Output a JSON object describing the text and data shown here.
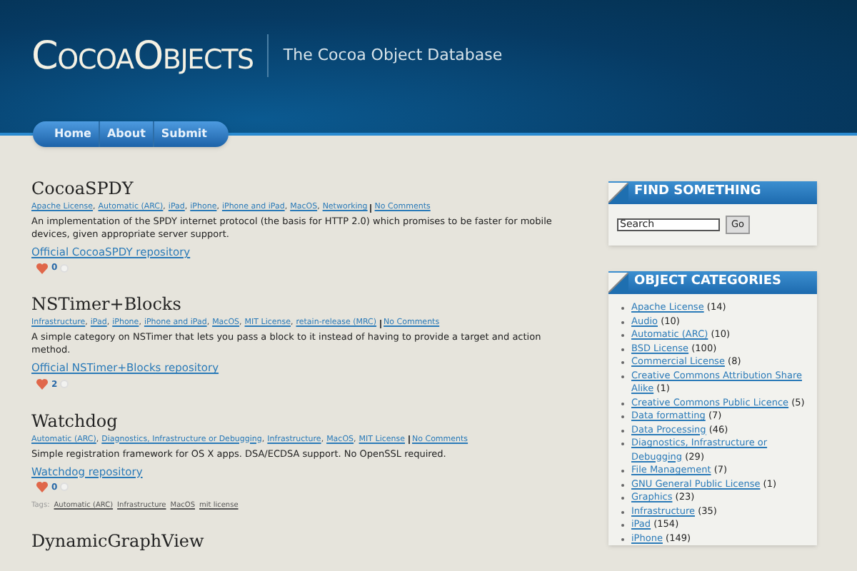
{
  "header": {
    "logo": "CocoaObjects",
    "tagline": "The Cocoa Object Database"
  },
  "nav": [
    {
      "label": "Home"
    },
    {
      "label": "About"
    },
    {
      "label": "Submit"
    }
  ],
  "posts": [
    {
      "title": "CocoaSPDY",
      "categories": [
        "Apache License",
        "Automatic (ARC)",
        "iPad",
        "iPhone",
        "iPhone and iPad",
        "MacOS",
        "Networking"
      ],
      "separator": ",",
      "comments": "No Comments",
      "description": "An implementation of the SPDY internet protocol (the basis for HTTP 2.0) which promises to be faster for mobile devices, given appropriate server support.",
      "link": "Official CocoaSPDY repository",
      "votes": "0"
    },
    {
      "title": "NSTimer+Blocks",
      "categories": [
        "Infrastructure",
        "iPad",
        "iPhone",
        "iPhone and iPad",
        "MacOS",
        "MIT License",
        "retain-release (MRC)"
      ],
      "separator": ",",
      "comments": "No Comments",
      "description": "A simple category on NSTimer that lets you pass a block to it instead of having to provide a target and action method.",
      "link": "Official NSTimer+Blocks repository",
      "votes": "2"
    },
    {
      "title": "Watchdog",
      "categories": [
        "Automatic (ARC)",
        "Diagnostics, Infrastructure or Debugging",
        "Infrastructure",
        "MacOS",
        "MIT License"
      ],
      "separator": ",",
      "comments": "No Comments",
      "description": "Simple registration framework for OS X apps. DSA/ECDSA support. No OpenSSL required.",
      "link": "Watchdog repository",
      "votes": "0",
      "tags_label": "Tags:",
      "tags": [
        "Automatic (ARC)",
        "Infrastructure",
        "MacOS",
        "mit license"
      ]
    },
    {
      "title": "DynamicGraphView"
    }
  ],
  "sidebar": {
    "search": {
      "title": "FIND SOMETHING",
      "value": "Search",
      "button": "Go"
    },
    "categories": {
      "title": "OBJECT CATEGORIES",
      "items": [
        {
          "name": "Apache License",
          "count": "(14)"
        },
        {
          "name": "Audio",
          "count": "(10)"
        },
        {
          "name": "Automatic (ARC)",
          "count": "(10)"
        },
        {
          "name": "BSD License",
          "count": "(100)"
        },
        {
          "name": "Commercial License",
          "count": "(8)"
        },
        {
          "name": "Creative Commons Attribution Share Alike",
          "count": "(1)"
        },
        {
          "name": "Creative Commons Public Licence",
          "count": "(5)"
        },
        {
          "name": "Data formatting",
          "count": "(7)"
        },
        {
          "name": "Data Processing",
          "count": "(46)"
        },
        {
          "name": "Diagnostics, Infrastructure or Debugging",
          "count": "(29)"
        },
        {
          "name": "File Management",
          "count": "(7)"
        },
        {
          "name": "GNU General Public License",
          "count": "(1)"
        },
        {
          "name": "Graphics",
          "count": "(23)"
        },
        {
          "name": "Infrastructure",
          "count": "(35)"
        },
        {
          "name": "iPad",
          "count": "(154)"
        },
        {
          "name": "iPhone",
          "count": "(149)"
        }
      ]
    }
  }
}
